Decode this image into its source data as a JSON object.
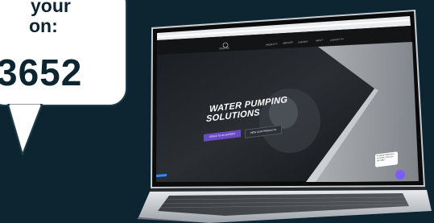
{
  "bubble": {
    "line1": "your",
    "line2": "on:",
    "code": "3652"
  },
  "site": {
    "brand": "TRICEL",
    "nav": [
      "PRODUCTS",
      "SERVICES",
      "TRAINING",
      "ABOUT",
      "CONTACT US"
    ],
    "hero_line1": "WATER PUMPING",
    "hero_line2": "SOLUTIONS",
    "primary_button": "SPEAK TO AN EXPERT",
    "secondary_button": "VIEW OUR PRODUCTS",
    "chat_text": "Hi there! Welcome to Tricel. How can we help?"
  },
  "colors": {
    "background": "#0d2530",
    "accent": "#6a4bc4",
    "chat": "#7b5cff"
  }
}
